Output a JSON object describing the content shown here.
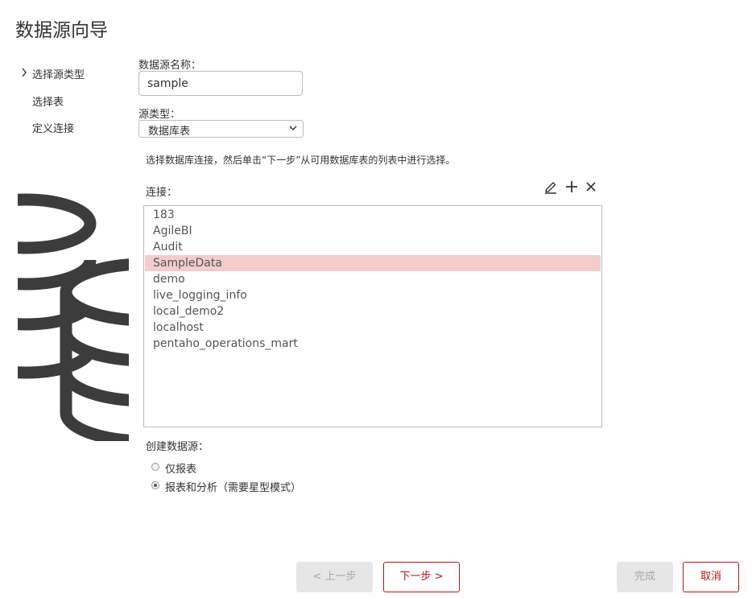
{
  "title": "数据源向导",
  "steps": [
    {
      "label": "选择源类型",
      "active": true
    },
    {
      "label": "选择表",
      "active": false
    },
    {
      "label": "定义连接",
      "active": false
    }
  ],
  "form": {
    "name_label": "数据源名称：",
    "name_value": "sample",
    "type_label": "源类型：",
    "type_value": "数据库表",
    "hint": "选择数据库连接，然后单击“下一步”从可用数据库表的列表中进行选择。",
    "connection_label": "连接：",
    "connections": [
      "183",
      "AgileBI",
      "Audit",
      "SampleData",
      "demo",
      "live_logging_info",
      "local_demo2",
      "localhost",
      "pentaho_operations_mart"
    ],
    "selected_connection": "SampleData",
    "create_label": "创建数据源：",
    "options": [
      {
        "label": "仅报表",
        "checked": false
      },
      {
        "label": "报表和分析（需要星型模式）",
        "checked": true
      }
    ]
  },
  "icons": {
    "edit": "pencil-icon",
    "add": "plus-icon",
    "delete": "close-icon",
    "illustration": "database-icon"
  },
  "buttons": {
    "back": "< 上一步",
    "next": "下一步 >",
    "finish": "完成",
    "cancel": "取消"
  },
  "colors": {
    "accent": "#b0191e",
    "selection": "#f3cccc",
    "illustration": "#3c3c3c"
  }
}
